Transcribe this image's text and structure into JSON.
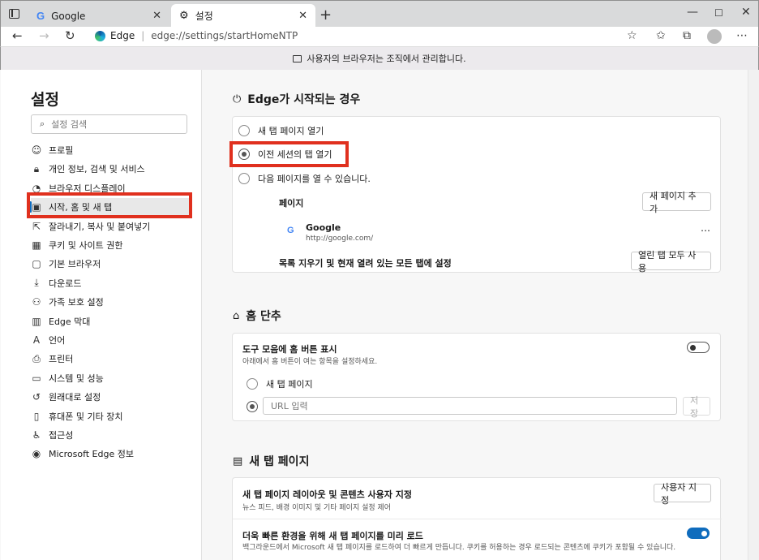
{
  "browser": {
    "tabs": [
      {
        "icon": "G",
        "label": "Google"
      },
      {
        "icon": "gear",
        "label": "설정"
      }
    ],
    "address": {
      "brand": "Edge",
      "url": "edge://settings/startHomeNTP"
    }
  },
  "managed_notice": "사용자의 브라우저는 조직에서 관리합니다.",
  "sidebar": {
    "title": "설정",
    "search_placeholder": "설정 검색",
    "items": [
      {
        "label": "프로필",
        "icon": "profile-icon"
      },
      {
        "label": "개인 정보, 검색 및 서비스",
        "icon": "lock-icon"
      },
      {
        "label": "브라우저 디스플레이",
        "icon": "appearance-icon"
      },
      {
        "label": "시작, 홈 및 새 탭",
        "icon": "start-home-icon"
      },
      {
        "label": "잘라내기, 복사 및 붙여넣기",
        "icon": "share-icon"
      },
      {
        "label": "쿠키 및 사이트 권한",
        "icon": "cookie-icon"
      },
      {
        "label": "기본 브라우저",
        "icon": "browser-icon"
      },
      {
        "label": "다운로드",
        "icon": "download-icon"
      },
      {
        "label": "가족 보호 설정",
        "icon": "family-icon"
      },
      {
        "label": "Edge 막대",
        "icon": "edge-bar-icon"
      },
      {
        "label": "언어",
        "icon": "language-icon"
      },
      {
        "label": "프린터",
        "icon": "printer-icon"
      },
      {
        "label": "시스템 및 성능",
        "icon": "system-icon"
      },
      {
        "label": "원래대로 설정",
        "icon": "reset-icon"
      },
      {
        "label": "휴대폰 및 기타 장치",
        "icon": "phone-icon"
      },
      {
        "label": "접근성",
        "icon": "accessibility-icon"
      },
      {
        "label": "Microsoft Edge 정보",
        "icon": "edge-logo-icon"
      }
    ],
    "selected_index": 3
  },
  "startup": {
    "title": "Edge가 시작되는 경우",
    "options": [
      "새 탭 페이지 열기",
      "이전 세션의 탭 열기",
      "다음 페이지를 열 수 있습니다."
    ],
    "selected_option": 1,
    "pages_label": "페이지",
    "add_page_button": "새 페이지 추가",
    "page": {
      "name": "Google",
      "url": "http://google.com/"
    },
    "clear_label": "목록 지우기 및 현재 열려 있는 모든 탭에 설정",
    "use_all_tabs_button": "열린 탭 모두 사용"
  },
  "home": {
    "title": "홈 단추",
    "show_label": "도구 모음에 홈 버튼 표시",
    "show_sub": "아래에서 홈 버튼이 여는 항목을 설정하세요.",
    "show_enabled": false,
    "option_newtab": "새 탭 페이지",
    "url_placeholder": "URL 입력",
    "save_button": "저장"
  },
  "newtab": {
    "title": "새 탭 페이지",
    "customize_label": "새 탭 페이지 레이아웃 및 콘텐츠 사용자 지정",
    "customize_sub": "뉴스 피드, 배경 이미지 및 기타 페이지 설정 제어",
    "customize_button": "사용자 지정",
    "preload_label": "더욱 빠른 환경을 위해 새 탭 페이지를 미리 로드",
    "preload_sub": "백그라운드에서 Microsoft 새 탭 페이지를 로드하여 더 빠르게 만듭니다. 쿠키를 허용하는 경우 로드되는 콘텐츠에 쿠키가 포함될 수 있습니다.",
    "preload_enabled": true
  },
  "colors": {
    "accent": "#0f6cbd",
    "highlight": "#e0301e"
  }
}
